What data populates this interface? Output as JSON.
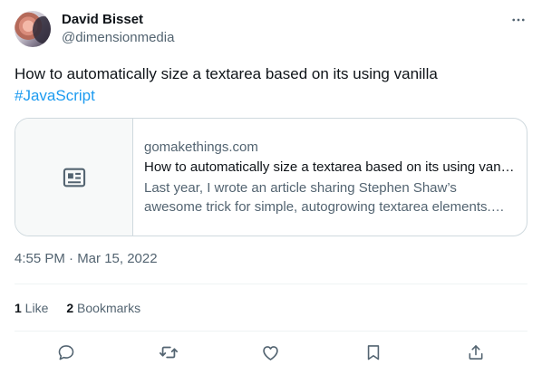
{
  "author": {
    "name": "David Bisset",
    "handle": "@dimensionmedia"
  },
  "tweet": {
    "text": "How to automatically size a textarea based on its using vanilla ",
    "hashtag": "#JavaScript"
  },
  "card": {
    "domain": "gomakethings.com",
    "title": "How to automatically size a textarea based on its using vanilla JavaScript",
    "description": "Last year, I wrote an article sharing Stephen Shaw’s awesome trick for simple, autogrowing textarea elements. Today, I want to show you how to do the same thing with vanilla JavaScript."
  },
  "meta": {
    "timestamp": "4:55 PM · Mar 15, 2022"
  },
  "stats": {
    "likes_count": "1",
    "likes_label": " Like",
    "bookmarks_count": "2",
    "bookmarks_label": " Bookmarks"
  },
  "colors": {
    "accent": "#1d9bf0",
    "text": "#0f1419",
    "secondary": "#536471",
    "border": "#cfd9de"
  },
  "icons": {
    "more": "more-icon",
    "article": "article-icon",
    "reply": "reply-icon",
    "retweet": "retweet-icon",
    "like": "like-icon",
    "bookmark": "bookmark-icon",
    "share": "share-icon"
  }
}
